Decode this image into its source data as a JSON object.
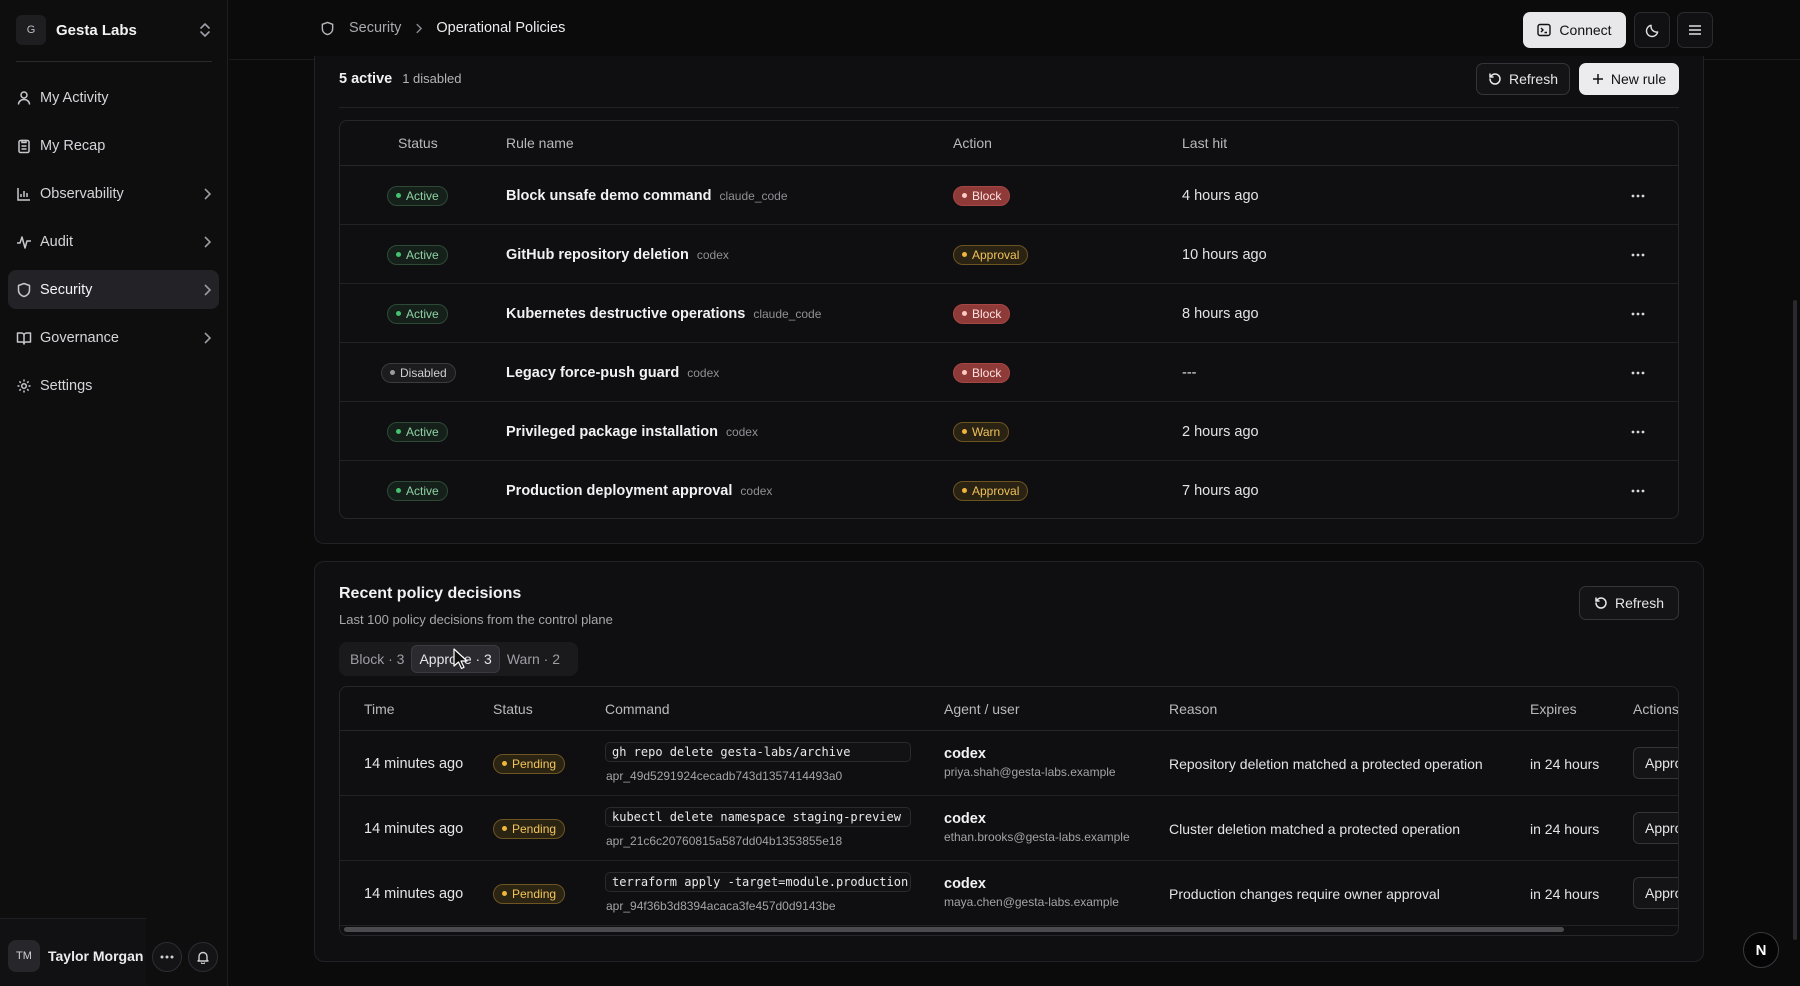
{
  "workspace": {
    "initial": "G",
    "name": "Gesta Labs"
  },
  "sidebar": {
    "items": [
      {
        "label": "My Activity",
        "icon": "user-icon"
      },
      {
        "label": "My Recap",
        "icon": "clipboard-icon"
      },
      {
        "label": "Observability",
        "icon": "bar-chart-icon"
      },
      {
        "label": "Audit",
        "icon": "activity-icon"
      },
      {
        "label": "Security",
        "icon": "shield-icon",
        "active": true
      },
      {
        "label": "Governance",
        "icon": "book-icon"
      },
      {
        "label": "Settings",
        "icon": "gear-icon"
      }
    ]
  },
  "user": {
    "initials": "TM",
    "name": "Taylor Morgan"
  },
  "header": {
    "breadcrumb": [
      "Security",
      "Operational Policies"
    ],
    "connect_label": "Connect"
  },
  "rules": {
    "active_count": "5 active",
    "disabled_count": "1 disabled",
    "refresh_label": "Refresh",
    "new_rule_label": "New rule",
    "columns": {
      "status": "Status",
      "name": "Rule name",
      "action": "Action",
      "last_hit": "Last hit"
    },
    "rows": [
      {
        "status": "Active",
        "name": "Block unsafe demo command",
        "agent": "claude_code",
        "action": "Block",
        "last_hit": "4 hours ago"
      },
      {
        "status": "Active",
        "name": "GitHub repository deletion",
        "agent": "codex",
        "action": "Approval",
        "last_hit": "10 hours ago"
      },
      {
        "status": "Active",
        "name": "Kubernetes destructive operations",
        "agent": "claude_code",
        "action": "Block",
        "last_hit": "8 hours ago"
      },
      {
        "status": "Disabled",
        "name": "Legacy force-push guard",
        "agent": "codex",
        "action": "Block",
        "last_hit": "---"
      },
      {
        "status": "Active",
        "name": "Privileged package installation",
        "agent": "codex",
        "action": "Warn",
        "last_hit": "2 hours ago"
      },
      {
        "status": "Active",
        "name": "Production deployment approval",
        "agent": "codex",
        "action": "Approval",
        "last_hit": "7 hours ago"
      }
    ]
  },
  "decisions": {
    "title": "Recent policy decisions",
    "subtitle": "Last 100 policy decisions from the control plane",
    "refresh_label": "Refresh",
    "filters": [
      "Block · 3",
      "Approve · 3",
      "Warn · 2"
    ],
    "selected_filter": "Approve · 3",
    "columns": {
      "time": "Time",
      "status": "Status",
      "command": "Command",
      "agent": "Agent / user",
      "reason": "Reason",
      "expires": "Expires",
      "actions": "Actions"
    },
    "rows": [
      {
        "time": "14 minutes ago",
        "status": "Pending",
        "command": "gh repo delete gesta-labs/archive",
        "id": "apr_49d5291924cecadb743d1357414493a0",
        "agent": "codex",
        "email": "priya.shah@gesta-labs.example",
        "reason": "Repository deletion matched a protected operation",
        "expires": "in 24 hours",
        "action_label": "Approve"
      },
      {
        "time": "14 minutes ago",
        "status": "Pending",
        "command": "kubectl delete namespace staging-preview",
        "id": "apr_21c6c20760815a587dd04b1353855e18",
        "agent": "codex",
        "email": "ethan.brooks@gesta-labs.example",
        "reason": "Cluster deletion matched a protected operation",
        "expires": "in 24 hours",
        "action_label": "Approve"
      },
      {
        "time": "14 minutes ago",
        "status": "Pending",
        "command": "terraform apply -target=module.production",
        "id": "apr_94f36b3d8394acaca3fe457d0d9143be",
        "agent": "codex",
        "email": "maya.chen@gesta-labs.example",
        "reason": "Production changes require owner approval",
        "expires": "in 24 hours",
        "action_label": "Approve"
      }
    ]
  },
  "fab_label": "N"
}
